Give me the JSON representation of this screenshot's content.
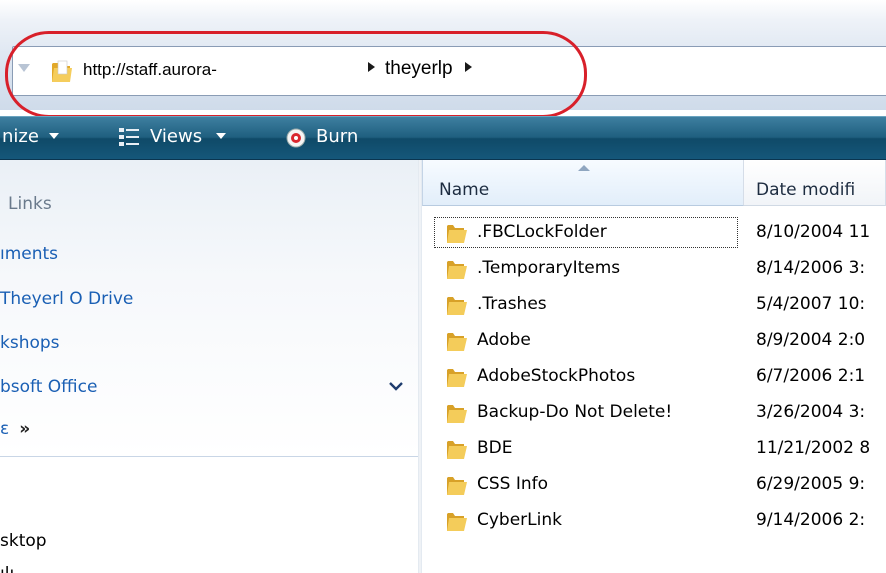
{
  "address_bar": {
    "url": "http://staff.aurora-",
    "crumb": "theyerlp"
  },
  "toolbar": {
    "organize_label": "nize",
    "views_label": "Views",
    "burn_label": "Burn"
  },
  "nav": {
    "links_heading": "Links",
    "links": [
      "ıments",
      "Theyerl O Drive",
      "kshops",
      "bsoft Office"
    ],
    "more_label": " ",
    "more_chevrons": "»",
    "folders": [
      "sktop",
      "ılı"
    ]
  },
  "file_list": {
    "columns": {
      "name": "Name",
      "date": "Date modifi"
    },
    "rows": [
      {
        "name": ".FBCLockFolder",
        "date": "8/10/2004 11"
      },
      {
        "name": ".TemporaryItems",
        "date": "8/14/2006 3:"
      },
      {
        "name": ".Trashes",
        "date": "5/4/2007 10:"
      },
      {
        "name": "Adobe",
        "date": "8/9/2004 2:0"
      },
      {
        "name": "AdobeStockPhotos",
        "date": "6/7/2006 2:1"
      },
      {
        "name": "Backup-Do Not Delete!",
        "date": "3/26/2004 3:"
      },
      {
        "name": "BDE",
        "date": "11/21/2002 8"
      },
      {
        "name": "CSS Info",
        "date": "6/29/2005 9:"
      },
      {
        "name": "CyberLink",
        "date": "9/14/2006 2:"
      }
    ]
  },
  "colors": {
    "toolbar": "#1f5f7f",
    "link": "#1a5fb4",
    "highlight_ring": "#d8202a"
  }
}
